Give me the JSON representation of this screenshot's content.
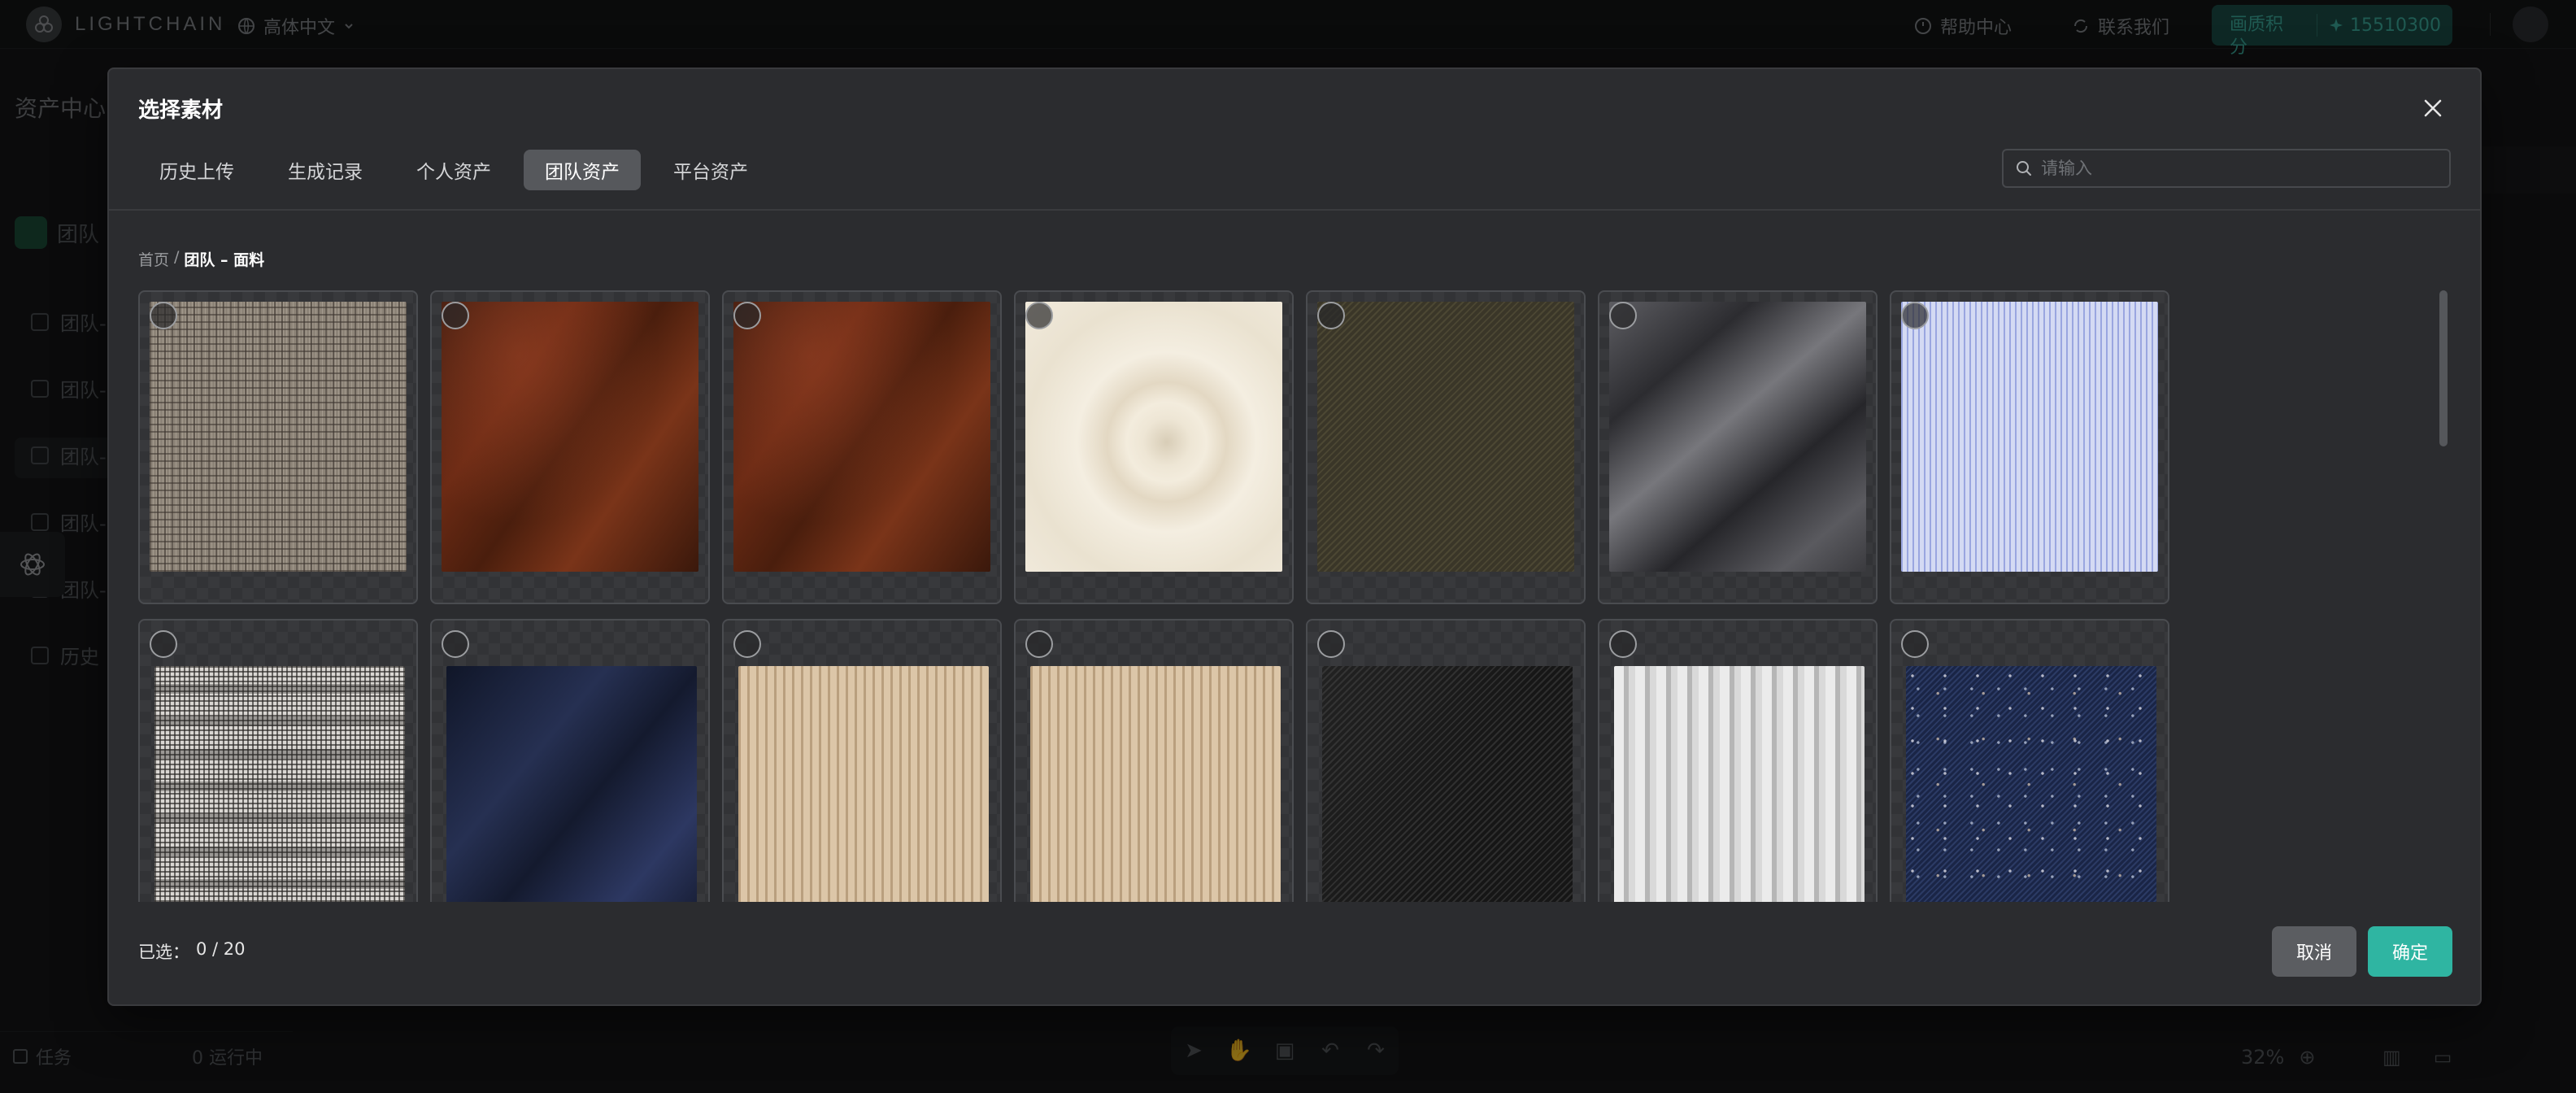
{
  "app": {
    "logo_text": "LIGHTCHAIN",
    "language": "高体中文",
    "help": "帮助中心",
    "contact": "联系我们",
    "credits_label": "画质积分",
    "credits_value": "15510300"
  },
  "sidebar": {
    "title": "资产中心",
    "team_label": "团队",
    "items": [
      "团队-",
      "团队-",
      "团队-",
      "团队-",
      "团队-",
      "历史"
    ],
    "tasks_label": "任务",
    "tasks_status": "0 运行中"
  },
  "canvas": {
    "zoom": "32%"
  },
  "modal": {
    "title": "选择素材",
    "tabs": [
      {
        "label": "历史上传",
        "active": false
      },
      {
        "label": "生成记录",
        "active": false
      },
      {
        "label": "个人资产",
        "active": false
      },
      {
        "label": "团队资产",
        "active": true
      },
      {
        "label": "平台资产",
        "active": false
      }
    ],
    "search_placeholder": "请输入",
    "breadcrumb": {
      "root": "首页",
      "separator": "/",
      "current": "团队 – 面料"
    },
    "materials": [
      {
        "texture": "plaid",
        "selected": false
      },
      {
        "texture": "brown-suede",
        "selected": false
      },
      {
        "texture": "brown-suede",
        "selected": false
      },
      {
        "texture": "cream-knit",
        "selected": false
      },
      {
        "texture": "olive-twill",
        "selected": false
      },
      {
        "texture": "grey-satin",
        "selected": false
      },
      {
        "texture": "blue-pinstripe",
        "selected": false
      },
      {
        "texture": "houndstooth",
        "selected": false
      },
      {
        "texture": "navy-wool",
        "selected": false
      },
      {
        "texture": "beige-rib",
        "selected": false
      },
      {
        "texture": "beige-rib",
        "selected": false
      },
      {
        "texture": "black-twill",
        "selected": false
      },
      {
        "texture": "seersucker",
        "selected": false
      },
      {
        "texture": "denim-tweed",
        "selected": false
      }
    ],
    "selected_label": "已选：",
    "selected_count": "0 / 20",
    "cancel_label": "取消",
    "confirm_label": "确定"
  },
  "colors": {
    "accent": "#2fb5a2",
    "modal_bg": "#2b2c2f",
    "tab_active_bg": "#56585c"
  }
}
